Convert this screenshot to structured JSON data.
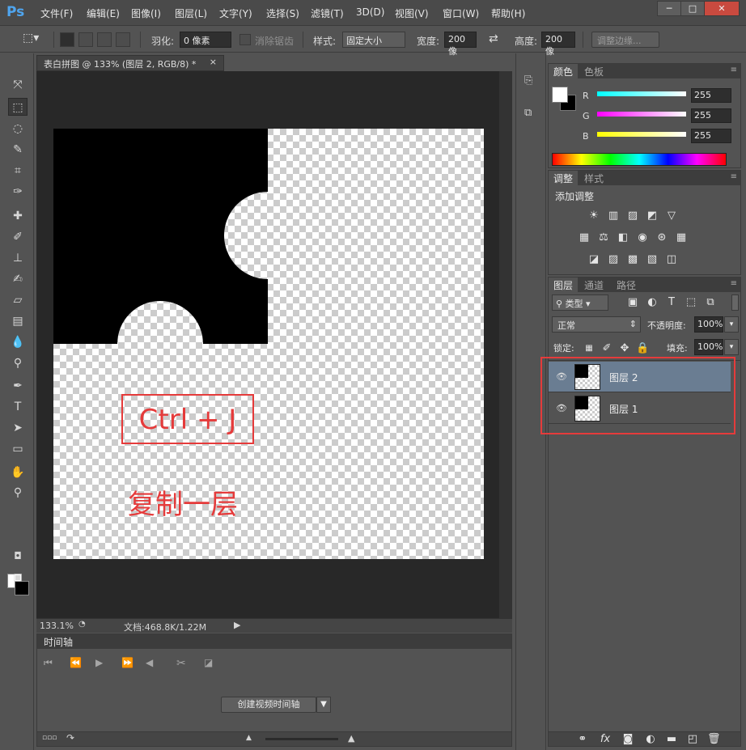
{
  "app": {
    "logo": "Ps"
  },
  "menu": [
    "文件(F)",
    "编辑(E)",
    "图像(I)",
    "图层(L)",
    "文字(Y)",
    "选择(S)",
    "滤镜(T)",
    "3D(D)",
    "视图(V)",
    "窗口(W)",
    "帮助(H)"
  ],
  "window_controls": {
    "min": "─",
    "max": "□",
    "close": "✕"
  },
  "options": {
    "feather_label": "羽化:",
    "feather_value": "0 像素",
    "antialias_label": "消除锯齿",
    "style_label": "样式:",
    "style_value": "固定大小",
    "width_label": "宽度:",
    "width_value": "200 像",
    "height_label": "高度:",
    "height_value": "200 像",
    "refine_edge": "调整边缘..."
  },
  "document": {
    "tab_title": "表白拼图 @ 133% (图层 2, RGB/8) *",
    "close": "×",
    "annotation_shortcut": "Ctrl + J",
    "annotation_caption": "复制一层"
  },
  "status": {
    "zoom": "133.1%",
    "doc_info": "文档:468.8K/1.22M"
  },
  "timeline": {
    "title": "时间轴",
    "create_button": "创建视频时间轴"
  },
  "color_panel": {
    "tabs": [
      "颜色",
      "色板"
    ],
    "channels": [
      {
        "label": "R",
        "value": "255",
        "gradient": "linear-gradient(to right, #00ffff, #ffffff)"
      },
      {
        "label": "G",
        "value": "255",
        "gradient": "linear-gradient(to right, #ff00ff, #ffffff)"
      },
      {
        "label": "B",
        "value": "255",
        "gradient": "linear-gradient(to right, #ffff00, #ffffff)"
      }
    ]
  },
  "adjust_panel": {
    "tabs": [
      "调整",
      "样式"
    ],
    "title": "添加调整"
  },
  "layers_panel": {
    "tabs": [
      "图层",
      "通道",
      "路径"
    ],
    "filter_label": "类型",
    "blend_mode": "正常",
    "opacity_label": "不透明度:",
    "opacity_value": "100%",
    "lock_label": "锁定:",
    "fill_label": "填充:",
    "fill_value": "100%",
    "layers": [
      {
        "name": "图层 2",
        "selected": true
      },
      {
        "name": "图层 1",
        "selected": false
      }
    ]
  },
  "colors": {
    "accent_red": "#e53b3b",
    "selected_layer": "#6a7d92",
    "ps_blue": "#4fa5ef"
  }
}
